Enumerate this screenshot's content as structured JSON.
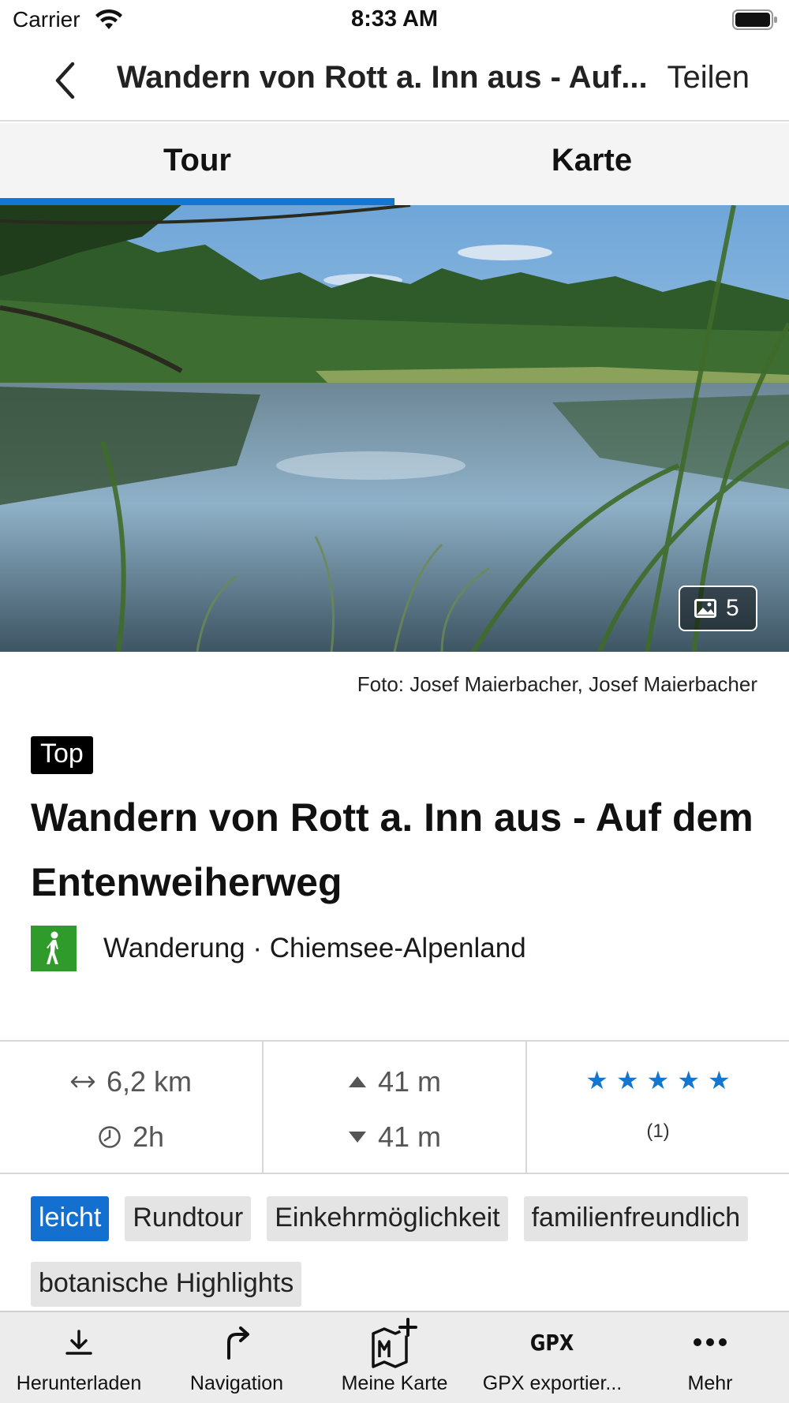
{
  "status_bar": {
    "carrier": "Carrier",
    "time": "8:33 AM"
  },
  "nav": {
    "title": "Wandern von Rott a. Inn aus - Auf...",
    "share_label": "Teilen"
  },
  "tabs": [
    {
      "label": "Tour",
      "active": true
    },
    {
      "label": "Karte",
      "active": false
    }
  ],
  "hero": {
    "photo_count": "5"
  },
  "credit": "Foto: Josef Maierbacher, Josef Maierbacher",
  "badge": "Top",
  "tour": {
    "title": "Wandern von Rott a. Inn aus - Auf dem Entenweiherweg",
    "category": "Wanderung · Chiemsee-Alpenland"
  },
  "stats": {
    "distance": "6,2 km",
    "duration": "2h",
    "ascent": "41 m",
    "descent": "41 m",
    "rating_stars": 5,
    "rating_count": "(1)"
  },
  "tags": [
    {
      "label": "leicht",
      "kind": "difficulty"
    },
    {
      "label": "Rundtour",
      "kind": "plain"
    },
    {
      "label": "Einkehrmöglichkeit",
      "kind": "plain"
    },
    {
      "label": "familienfreundlich",
      "kind": "plain"
    },
    {
      "label": "botanische Highlights",
      "kind": "plain"
    }
  ],
  "bottom_bar": [
    {
      "label": "Herunterladen",
      "icon": "download-icon"
    },
    {
      "label": "Navigation",
      "icon": "turn-right-arrow-icon"
    },
    {
      "label": "Meine Karte",
      "icon": "map-add-icon"
    },
    {
      "label": "GPX exportier...",
      "icon": "gpx-icon",
      "icon_text": "GPX"
    },
    {
      "label": "Mehr",
      "icon": "more-dots-icon"
    }
  ],
  "colors": {
    "accent": "#1476d3",
    "difficulty_easy": "#1370d0",
    "hike_green": "#2e9b2b",
    "star": "#1477cf"
  }
}
